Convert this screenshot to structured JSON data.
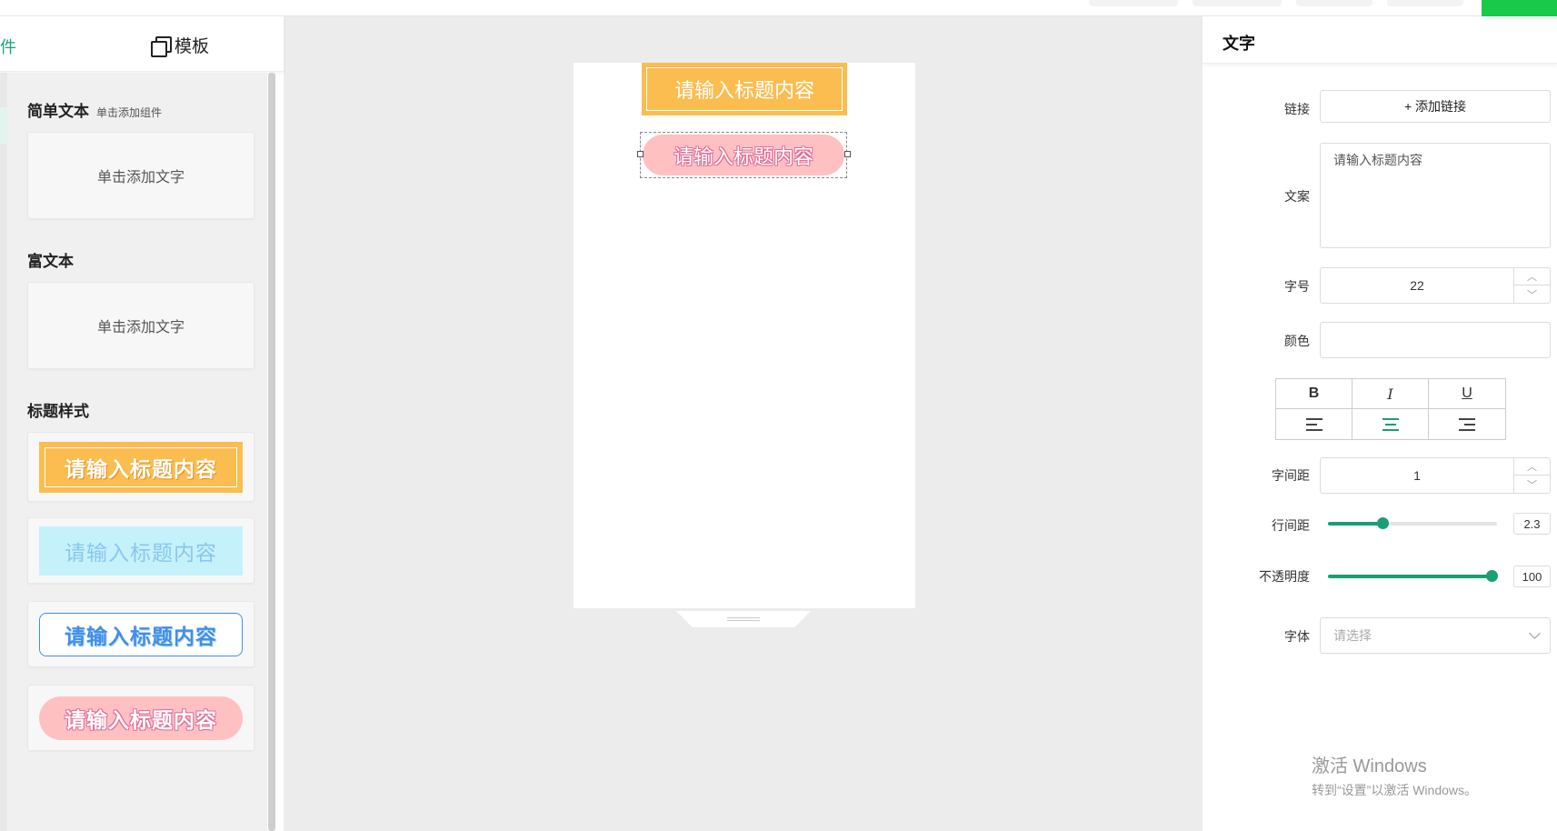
{
  "left": {
    "tab_fragment": "件",
    "tab_template": "模板",
    "sections": {
      "simple": {
        "title": "简单文本",
        "subtitle": "单击添加组件",
        "card": "单击添加文字"
      },
      "rich": {
        "title": "富文本",
        "card": "单击添加文字"
      },
      "title_styles": {
        "title": "标题样式",
        "items": [
          "请输入标题内容",
          "请输入标题内容",
          "请输入标题内容",
          "请输入标题内容"
        ]
      }
    }
  },
  "canvas": {
    "title1": "请输入标题内容",
    "title2": "请输入标题内容"
  },
  "right": {
    "header": "文字",
    "link_label": "链接",
    "link_button": "+ 添加链接",
    "copy_label": "文案",
    "copy_value": "请输入标题内容",
    "size_label": "字号",
    "size_value": "22",
    "color_label": "颜色",
    "format": {
      "bold": "B",
      "italic": "I",
      "underline": "U"
    },
    "spacing_label": "字间距",
    "spacing_value": "1",
    "line_label": "行间距",
    "line_value": "2.3",
    "opacity_label": "不透明度",
    "opacity_value": "100",
    "font_label": "字体",
    "font_placeholder": "请选择",
    "accent": "#1a9e75"
  },
  "watermark": {
    "line1": "激活 Windows",
    "line2": "转到“设置”以激活 Windows。"
  }
}
